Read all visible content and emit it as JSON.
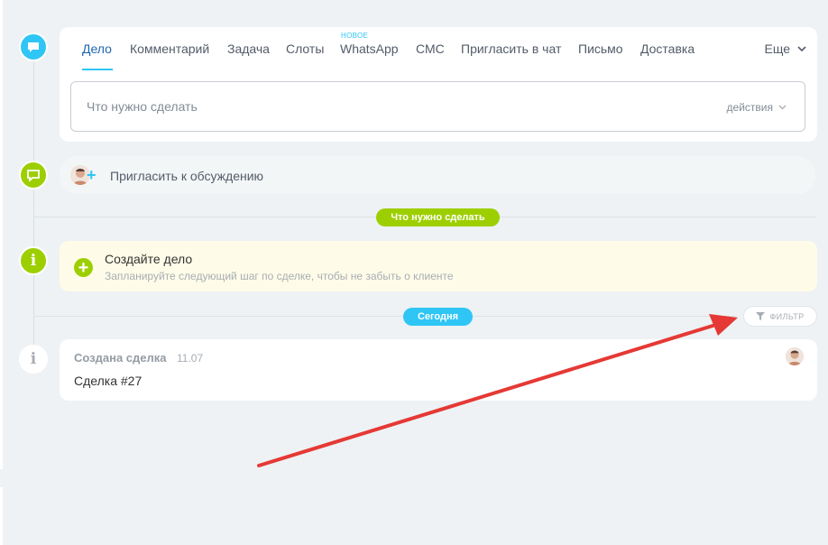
{
  "tabs": [
    {
      "label": "Дело",
      "active": true
    },
    {
      "label": "Комментарий"
    },
    {
      "label": "Задача"
    },
    {
      "label": "Слоты"
    },
    {
      "label": "WhatsApp",
      "badge": "НОВОЕ"
    },
    {
      "label": "СМС"
    },
    {
      "label": "Пригласить в чат"
    },
    {
      "label": "Письмо"
    },
    {
      "label": "Доставка"
    }
  ],
  "more_label": "Еще",
  "todo": {
    "placeholder": "Что нужно сделать",
    "actions_label": "действия"
  },
  "invite": {
    "label": "Пригласить к обсуждению"
  },
  "pills": {
    "todo": "Что нужно сделать",
    "today": "Сегодня"
  },
  "create_task": {
    "title": "Создайте дело",
    "subtitle": "Запланируйте следующий шаг по сделке, чтобы не забыть о клиенте"
  },
  "filter_label": "ФИЛЬТР",
  "deal_event": {
    "title": "Создана сделка",
    "time": "11.07",
    "name": "Сделка #27"
  },
  "colors": {
    "accent_blue": "#2fc6f6",
    "active_tab": "#2067b0",
    "green": "#9dcf00",
    "arrow_red": "#e53935",
    "background": "#eef2f4"
  },
  "icons": {
    "activity": "chat-bubble-icon",
    "comment": "comment-icon",
    "info": "info-icon",
    "filter": "filter-icon"
  }
}
